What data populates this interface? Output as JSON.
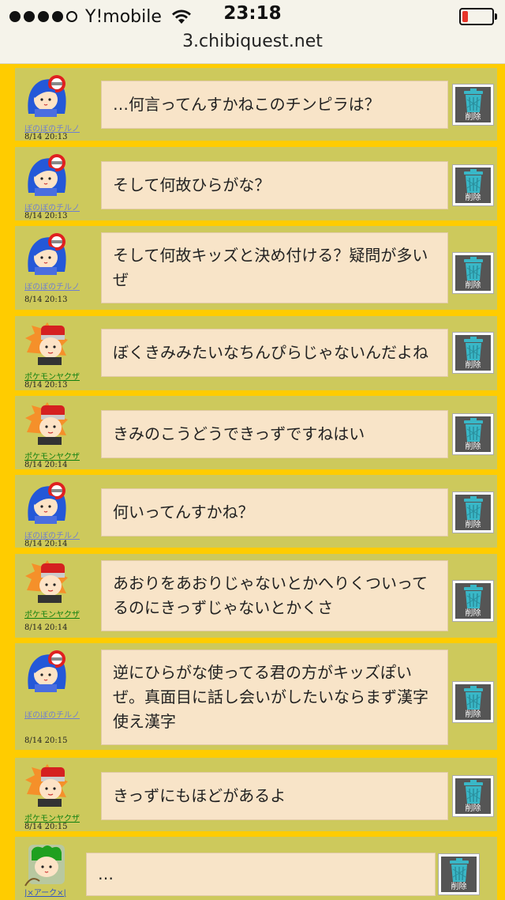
{
  "status_bar": {
    "carrier": "Y!mobile",
    "time": "23:18",
    "url": "3.chibiquest.net",
    "battery_level": 0.2
  },
  "delete_label": "削除",
  "messages": [
    {
      "user": "ぼのぼのチルノ",
      "time": "8/14 20:13",
      "text": "…何言ってんすかねこのチンピラは？",
      "avatar": "blue-hair-avatar"
    },
    {
      "user": "ぼのぼのチルノ",
      "time": "8/14 20:13",
      "text": "そして何故ひらがな？",
      "avatar": "blue-hair-avatar"
    },
    {
      "user": "ぼのぼのチルノ",
      "time": "8/14 20:13",
      "text": "そして何故キッズと決め付ける？疑問が多いぜ",
      "avatar": "blue-hair-avatar"
    },
    {
      "user": "ポケモンヤクザ",
      "time": "8/14 20:13",
      "text": "ぼくきみみたいなちんぴらじゃないんだよね",
      "avatar": "orange-hair-avatar"
    },
    {
      "user": "ポケモンヤクザ",
      "time": "8/14 20:14",
      "text": "きみのこうどうできっずですねはい",
      "avatar": "orange-hair-avatar"
    },
    {
      "user": "ぼのぼのチルノ",
      "time": "8/14 20:14",
      "text": "何いってんすかね？",
      "avatar": "blue-hair-avatar"
    },
    {
      "user": "ポケモンヤクザ",
      "time": "8/14 20:14",
      "text": "あおりをあおりじゃないとかへりくついってるのにきっずじゃないとかくさ",
      "avatar": "orange-hair-avatar"
    },
    {
      "user": "ぼのぼのチルノ",
      "time": "8/14 20:15",
      "text": "逆にひらがな使ってる君の方がキッズぽいぜ。真面目に話し会いがしたいならまず漢字使え漢字",
      "avatar": "blue-hair-avatar"
    },
    {
      "user": "ポケモンヤクザ",
      "time": "8/14 20:15",
      "text": "きっずにもほどがあるよ",
      "avatar": "orange-hair-avatar"
    },
    {
      "user": "|×アーク×|",
      "time": "",
      "text": "…",
      "avatar": "green-hair-avatar"
    }
  ]
}
